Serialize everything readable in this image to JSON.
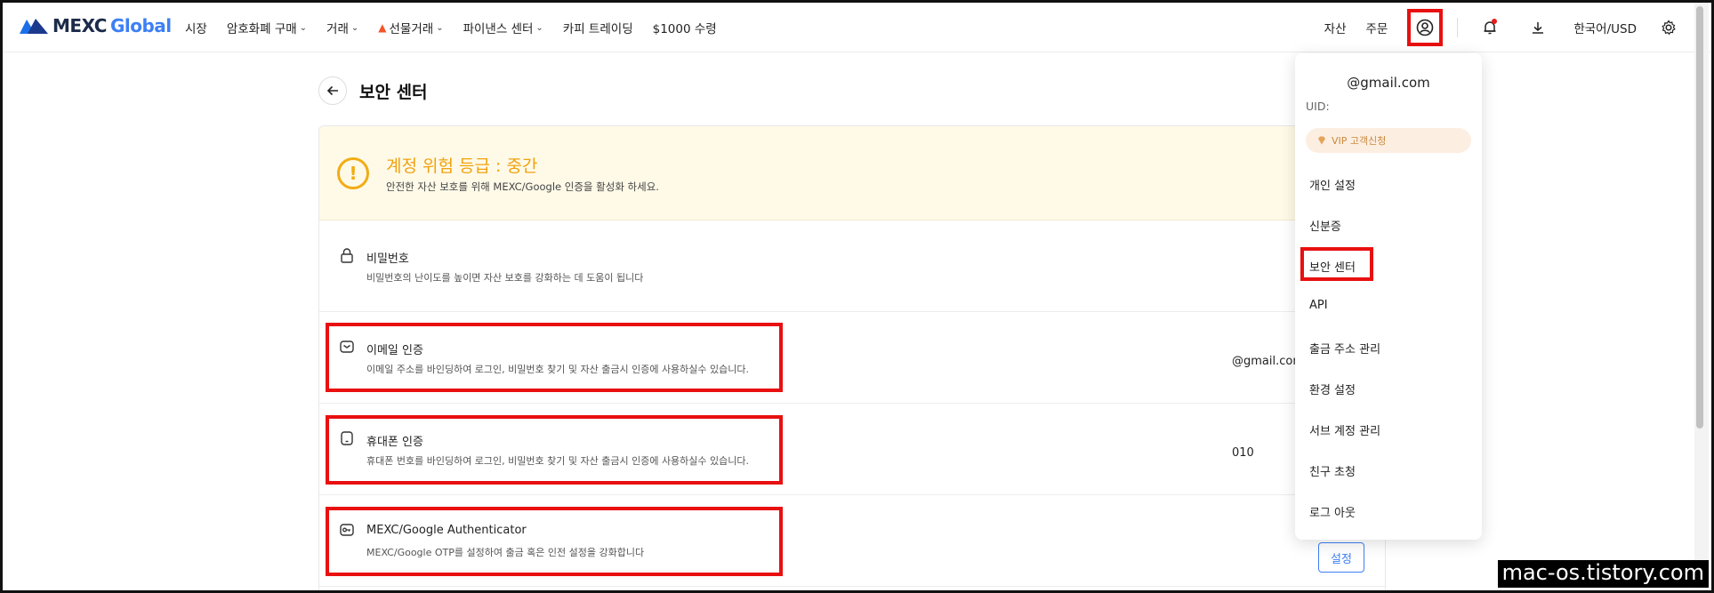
{
  "brand": {
    "name_a": "MEXC",
    "name_b": "Global"
  },
  "nav": {
    "items": [
      {
        "label": "시장",
        "chevron": false,
        "fire": false
      },
      {
        "label": "암호화폐 구매",
        "chevron": true,
        "fire": false
      },
      {
        "label": "거래",
        "chevron": true,
        "fire": false
      },
      {
        "label": "선물거래",
        "chevron": true,
        "fire": true
      },
      {
        "label": "파이낸스 센터",
        "chevron": true,
        "fire": false
      },
      {
        "label": "카피 트레이딩",
        "chevron": false,
        "fire": false
      },
      {
        "label": "$1000 수령",
        "chevron": false,
        "fire": false
      }
    ],
    "right": {
      "assets": "자산",
      "orders": "주문",
      "language": "한국어/USD"
    }
  },
  "page": {
    "title": "보안 센터",
    "warning": {
      "title": "계정 위험 등급 :  중간",
      "desc": "안전한 자산 보호를 위해 MEXC/Google 인증을 활성화 하세요."
    },
    "rows": [
      {
        "id": "password",
        "title": "비밀번호",
        "desc": "비밀번호의 난이도를 높이면 자산 보호를 강화하는 데 도움이 됩니다",
        "value": ""
      },
      {
        "id": "email",
        "title": "이메일 인증",
        "desc": "이메일 주소를 바인딩하여 로그인, 비밀번호 찾기 및 자산 출금시 인증에 사용하실수 있습니다.",
        "value": "@gmail.com"
      },
      {
        "id": "phone",
        "title": "휴대폰 인증",
        "desc": "휴대폰 번호를 바인딩하여 로그인, 비밀번호 찾기 및 자산 출금시 인증에 사용하실수 있습니다.",
        "value": "010"
      },
      {
        "id": "google",
        "title": "MEXC/Google Authenticator",
        "desc": "MEXC/Google OTP를 설정하여 출금 혹은 인전 설정을 강화합니다",
        "value": "",
        "button": "설정"
      }
    ]
  },
  "dropdown": {
    "email": "@gmail.com",
    "uid_label": "UID:",
    "vip_label": "VIP 고객신청",
    "items": [
      "개인 설정",
      "신분증",
      "보안 센터",
      "API",
      "출금 주소 관리",
      "환경 설정",
      "서브 계정 관리",
      "친구 초청",
      "로그 아웃"
    ]
  },
  "watermark": "mac-os.tistory.com",
  "colors": {
    "highlight": "#e81010",
    "accent_blue": "#3d7ff5",
    "warning": "#f0a20e"
  }
}
